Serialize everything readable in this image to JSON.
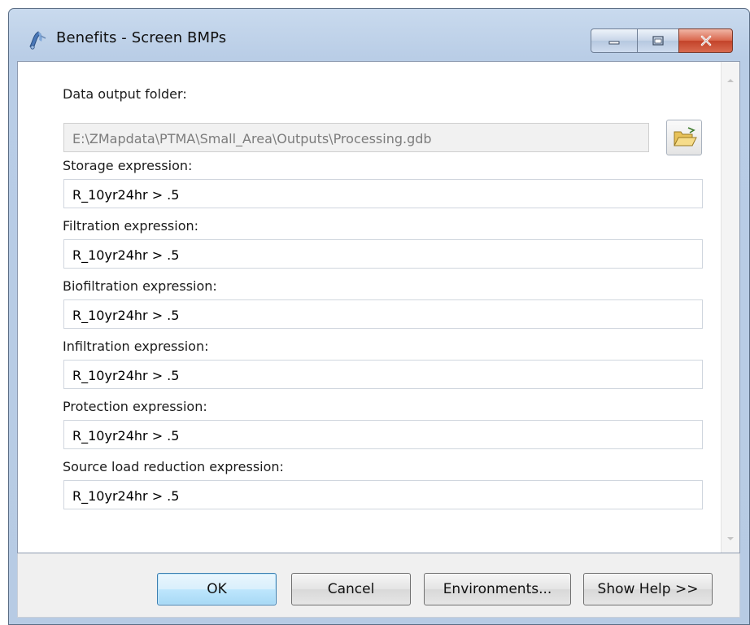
{
  "window": {
    "title": "Benefits - Screen BMPs"
  },
  "form": {
    "output_folder": {
      "label": "Data output folder:",
      "value": "E:\\ZMapdata\\PTMA\\Small_Area\\Outputs\\Processing.gdb"
    },
    "fields": [
      {
        "label": "Storage expression:",
        "value": "R_10yr24hr > .5"
      },
      {
        "label": "Filtration expression:",
        "value": "R_10yr24hr > .5"
      },
      {
        "label": "Biofiltration expression:",
        "value": "R_10yr24hr > .5"
      },
      {
        "label": "Infiltration expression:",
        "value": "R_10yr24hr > .5"
      },
      {
        "label": "Protection expression:",
        "value": "R_10yr24hr > .5"
      },
      {
        "label": "Source load reduction expression:",
        "value": "R_10yr24hr > .5"
      }
    ]
  },
  "buttons": {
    "ok": "OK",
    "cancel": "Cancel",
    "environments": "Environments...",
    "show_help": "Show Help >>"
  },
  "icons": {
    "title": "python-script-icon",
    "browse": "open-folder-icon",
    "minimize": "minimize-icon",
    "maximize": "maximize-icon",
    "close": "close-icon"
  },
  "colors": {
    "title_bar": "#c9daee",
    "close_button": "#d9654b",
    "default_button": "#bee6fd"
  }
}
